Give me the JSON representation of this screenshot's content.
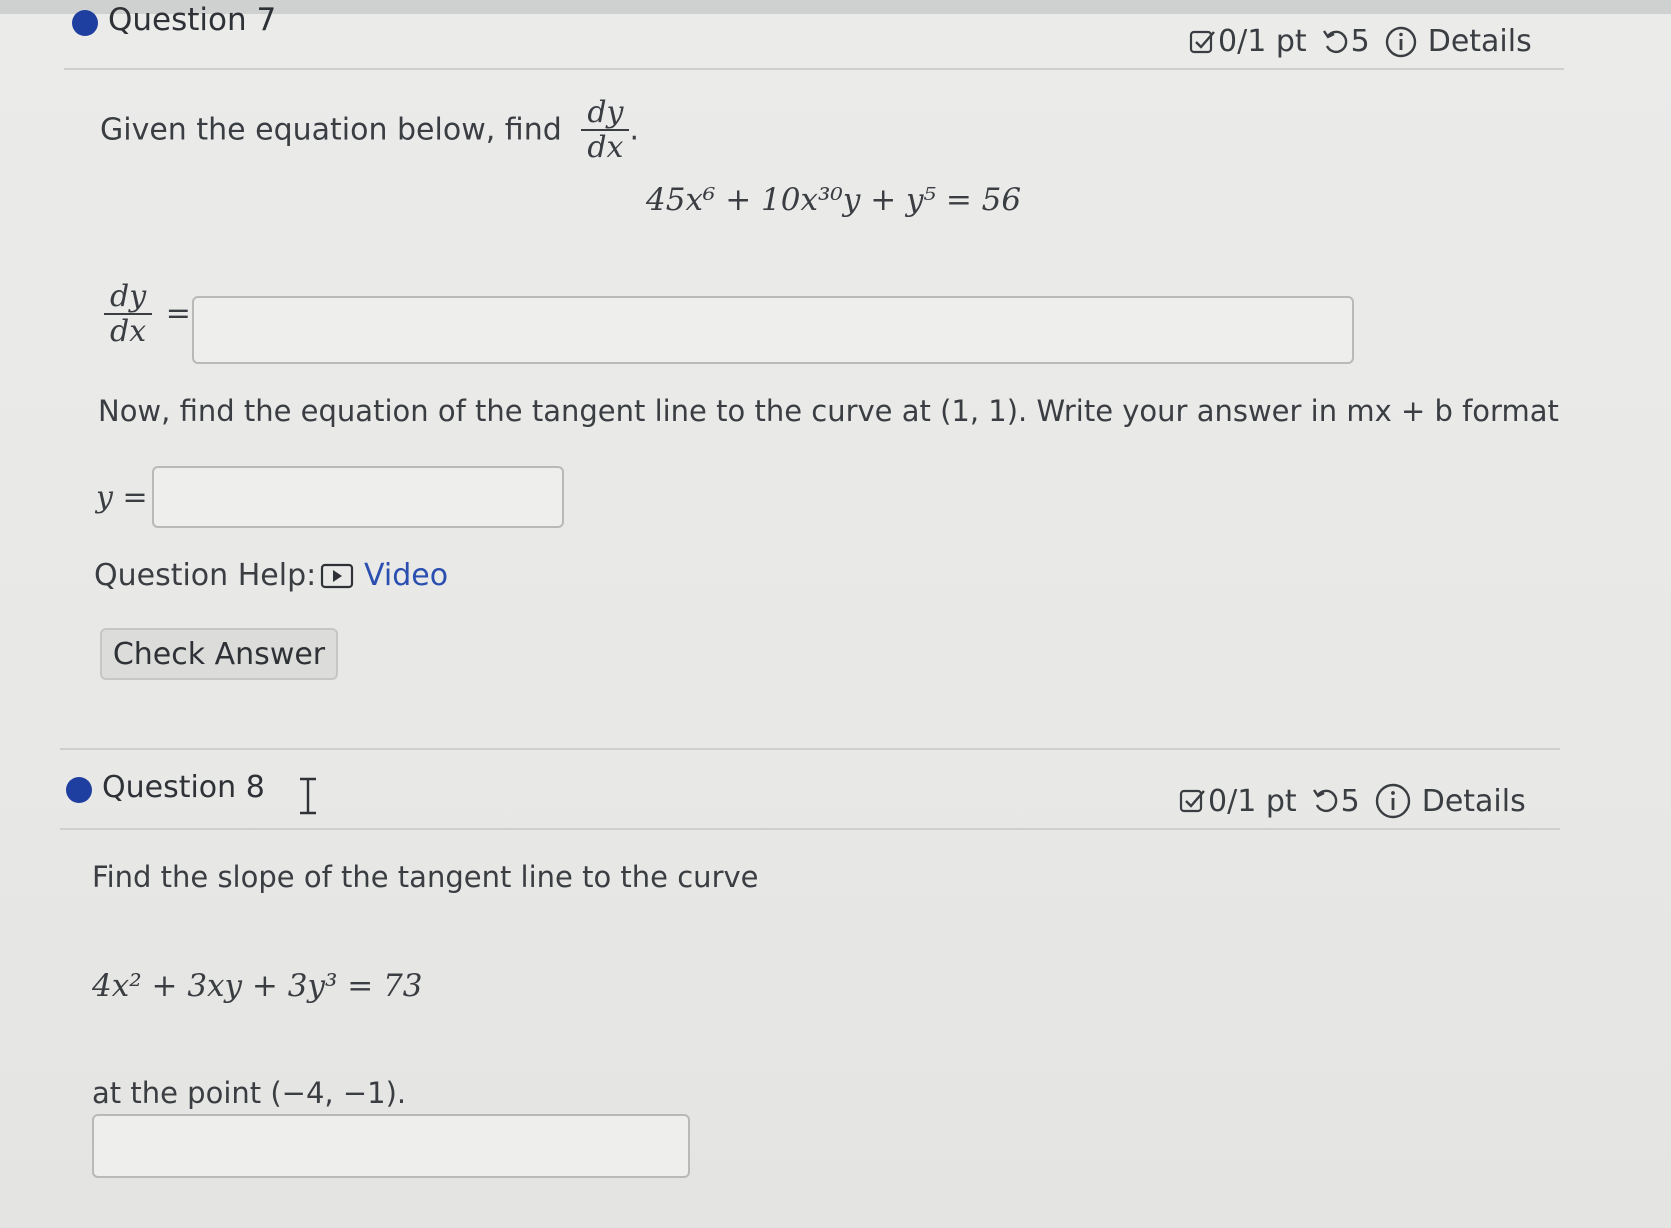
{
  "question7": {
    "title": "Question 7",
    "meta": {
      "points": "0/1 pt",
      "attempts": "5",
      "details": "Details"
    },
    "prompt_prefix": "Given the equation below, find",
    "prompt_frac_num": "dy",
    "prompt_frac_den": "dx",
    "equation": "45x⁶ + 10x³⁰y + y⁵ = 56",
    "answer1_label_num": "dy",
    "answer1_label_den": "dx",
    "answer1_equals": "=",
    "answer1_value": "",
    "tangent_prompt": "Now, find the equation of the tangent line to the curve at (1, 1). Write your answer in mx + b format",
    "answer2_label": "y =",
    "answer2_value": "",
    "help_label": "Question Help:",
    "help_video": "Video",
    "check_button": "Check Answer"
  },
  "question8": {
    "title": "Question 8",
    "meta": {
      "points": "0/1 pt",
      "attempts": "5",
      "details": "Details"
    },
    "prompt": "Find the slope of the tangent line to the curve",
    "equation": "4x² + 3xy + 3y³ = 73",
    "point_text": "at the point (−4, −1).",
    "answer_value": ""
  },
  "colors": {
    "accent": "#1f3fa0",
    "link": "#2a4fb0",
    "background": "#e8e8e6"
  },
  "icons": [
    "checkbox-icon",
    "retry-icon",
    "info-icon",
    "video-icon",
    "text-cursor-icon"
  ]
}
